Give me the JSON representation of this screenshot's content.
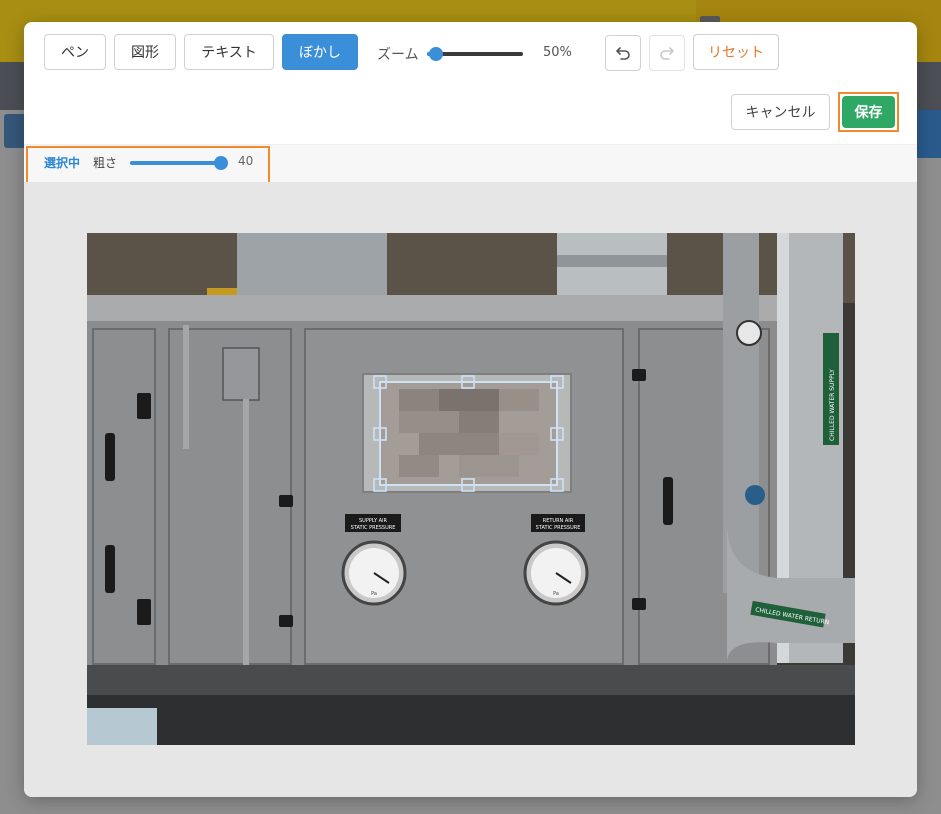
{
  "toolbar": {
    "pen_label": "ペン",
    "shape_label": "図形",
    "text_label": "テキスト",
    "blur_label": "ぼかし",
    "zoom_label": "ズーム",
    "zoom_value": "50%",
    "zoom_level": 0.05,
    "undo_icon": "undo-icon",
    "redo_icon": "redo-icon",
    "reset_label": "リセット",
    "cancel_label": "キャンセル",
    "save_label": "保存"
  },
  "options": {
    "selected_label": "選択中",
    "roughness_label": "粗さ",
    "roughness_value": "40",
    "roughness_level": 1.0
  },
  "photo": {
    "supply_sign_line1": "SUPPLY AIR",
    "supply_sign_line2": "STATIC PRESSURE",
    "return_sign_line1": "RETURN AIR",
    "return_sign_line2": "STATIC PRESSURE",
    "chilled_supply": "CHILLED WATER SUPPLY",
    "chilled_return": "CHILLED WATER RETURN",
    "gauge_unit": "Pa",
    "gauge_ticks": [
      "0",
      "500",
      "1000",
      "1500",
      "2000",
      "2500"
    ]
  },
  "colors": {
    "accent": "#3a8fd8",
    "save": "#2fa765",
    "reset": "#e07a28",
    "highlight_outline": "#f08a2c"
  }
}
